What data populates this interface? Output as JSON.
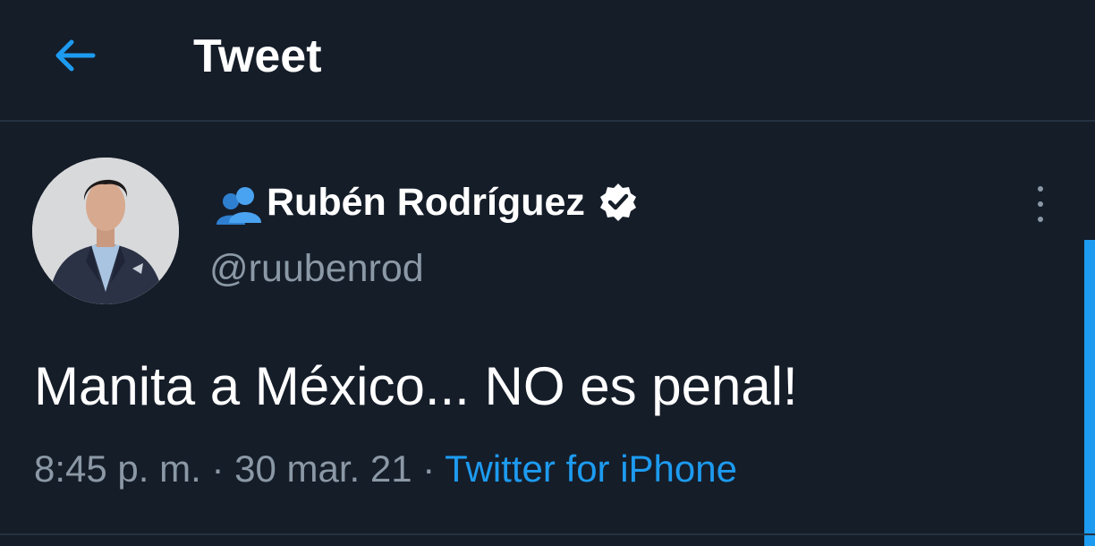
{
  "header": {
    "title": "Tweet",
    "back_icon": "arrow-left-icon"
  },
  "tweet": {
    "author": {
      "display_name": "Rubén Rodríguez",
      "handle": "@ruubenrod",
      "verified_icon": "verified-badge-icon",
      "emoji_icon": "busts-in-silhouette-icon"
    },
    "text": "Manita a México... NO es penal!",
    "time": "8:45 p. m.",
    "separator": "·",
    "date": "30 mar. 21",
    "source": "Twitter for iPhone",
    "more_icon": "more-vertical-icon"
  },
  "colors": {
    "background": "#151d29",
    "accent": "#1d9bf0",
    "secondary_text": "#8b98a5",
    "text": "#ffffff"
  }
}
